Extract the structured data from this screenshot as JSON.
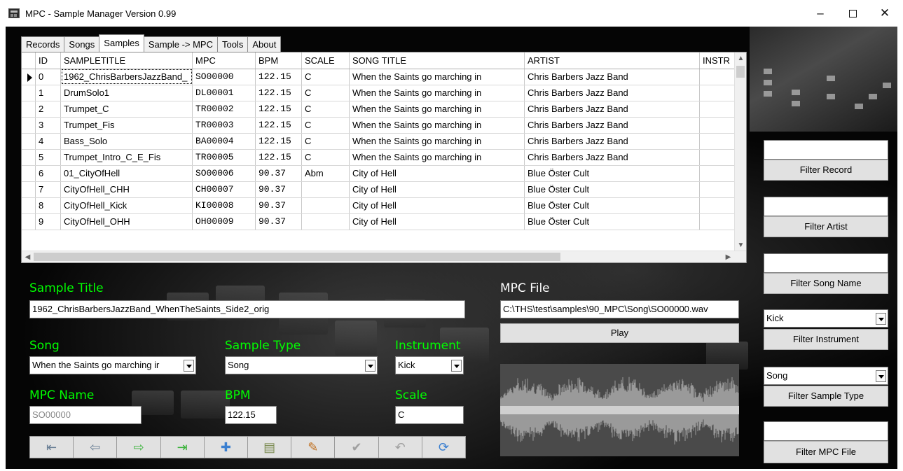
{
  "window": {
    "title": "MPC - Sample Manager Version 0.99",
    "controls": {
      "minimize": "–",
      "close": "✕"
    }
  },
  "tabs": [
    {
      "label": "Records",
      "active": false
    },
    {
      "label": "Songs",
      "active": false
    },
    {
      "label": "Samples",
      "active": true
    },
    {
      "label": "Sample -> MPC",
      "active": false
    },
    {
      "label": "Tools",
      "active": false
    },
    {
      "label": "About",
      "active": false
    }
  ],
  "grid": {
    "columns": [
      "ID",
      "SAMPLETITLE",
      "MPC",
      "BPM",
      "SCALE",
      "SONG TITLE",
      "ARTIST",
      "INSTR"
    ],
    "rows": [
      [
        "0",
        "1962_ChrisBarbersJazzBand_",
        "SO00000",
        "122.15",
        "C",
        "When the Saints go marching in",
        "Chris Barbers Jazz Band",
        ""
      ],
      [
        "1",
        "DrumSolo1",
        "DL00001",
        "122.15",
        "C",
        "When the Saints go marching in",
        "Chris Barbers Jazz Band",
        ""
      ],
      [
        "2",
        "Trumpet_C",
        "TR00002",
        "122.15",
        "C",
        "When the Saints go marching in",
        "Chris Barbers Jazz Band",
        ""
      ],
      [
        "3",
        "Trumpet_Fis",
        "TR00003",
        "122.15",
        "C",
        "When the Saints go marching in",
        "Chris Barbers Jazz Band",
        ""
      ],
      [
        "4",
        "Bass_Solo",
        "BA00004",
        "122.15",
        "C",
        "When the Saints go marching in",
        "Chris Barbers Jazz Band",
        ""
      ],
      [
        "5",
        "Trumpet_Intro_C_E_Fis",
        "TR00005",
        "122.15",
        "C",
        "When the Saints go marching in",
        "Chris Barbers Jazz Band",
        ""
      ],
      [
        "6",
        "01_CityOfHell",
        "SO00006",
        "90.37",
        "Abm",
        "City of Hell",
        "Blue Öster Cult",
        ""
      ],
      [
        "7",
        "CityOfHell_CHH",
        "CH00007",
        "90.37",
        "",
        "City of Hell",
        "Blue Öster Cult",
        ""
      ],
      [
        "8",
        "CityOfHell_Kick",
        "KI00008",
        "90.37",
        "",
        "City of Hell",
        "Blue Öster Cult",
        ""
      ],
      [
        "9",
        "CityOfHell_OHH",
        "OH00009",
        "90.37",
        "",
        "City of Hell",
        "Blue Öster Cult",
        ""
      ]
    ],
    "selected_row": 0
  },
  "form": {
    "sample_title_label": "Sample Title",
    "sample_title_value": "1962_ChrisBarbersJazzBand_WhenTheSaints_Side2_orig",
    "mpc_file_label": "MPC File",
    "mpc_file_value": "C:\\THS\\test\\samples\\90_MPC\\Song\\SO00000.wav",
    "play_label": "Play",
    "song_label": "Song",
    "song_value": "When the Saints go marching ir",
    "sample_type_label": "Sample Type",
    "sample_type_value": "Song",
    "instrument_label": "Instrument",
    "instrument_value": "Kick",
    "mpc_name_label": "MPC Name",
    "mpc_name_value": "SO00000",
    "bpm_label": "BPM",
    "bpm_value": "122.15",
    "scale_label": "Scale",
    "scale_value": "C"
  },
  "navigation": [
    {
      "icon": "first-record-icon",
      "glyph": "⇤"
    },
    {
      "icon": "previous-record-icon",
      "glyph": "⇦"
    },
    {
      "icon": "next-record-icon",
      "glyph": "⇨"
    },
    {
      "icon": "last-record-icon",
      "glyph": "⇥"
    },
    {
      "icon": "add-record-icon",
      "glyph": "✚"
    },
    {
      "icon": "delete-record-icon",
      "glyph": "▤"
    },
    {
      "icon": "edit-record-icon",
      "glyph": "✎"
    },
    {
      "icon": "post-record-icon",
      "glyph": "✔"
    },
    {
      "icon": "cancel-edit-icon",
      "glyph": "↶"
    },
    {
      "icon": "refresh-icon",
      "glyph": "⟳"
    }
  ],
  "filters": {
    "record_value": "",
    "record_button": "Filter Record",
    "artist_value": "",
    "artist_button": "Filter Artist",
    "song_name_value": "",
    "song_name_button": "Filter Song Name",
    "instrument_value": "Kick",
    "instrument_button": "Filter Instrument",
    "sample_type_value": "Song",
    "sample_type_button": "Filter Sample Type",
    "mpc_file_value": "",
    "mpc_file_button": "Filter MPC File"
  },
  "colors": {
    "label_green": "#00ff00",
    "background": "#000000",
    "button_face": "#e1e1e1"
  }
}
